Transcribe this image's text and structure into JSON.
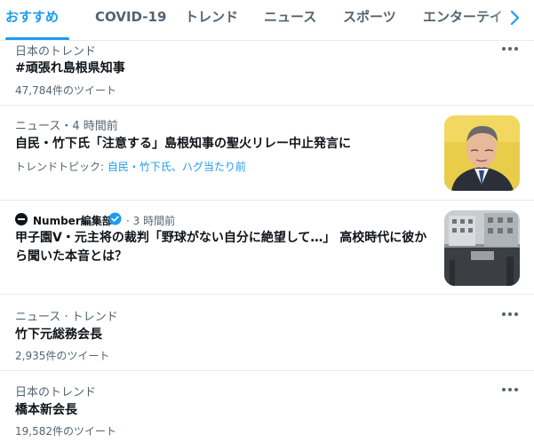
{
  "tabs": [
    {
      "label": "おすすめ",
      "active": true
    },
    {
      "label": "COVID-19",
      "active": false
    },
    {
      "label": "トレンド",
      "active": false
    },
    {
      "label": "ニュース",
      "active": false
    },
    {
      "label": "スポーツ",
      "active": false
    },
    {
      "label": "エンターテイ",
      "active": false
    }
  ],
  "colors": {
    "accent": "#1d9bf0",
    "text": "#0f1419",
    "muted": "#536471",
    "border": "#e6ecf0"
  },
  "trend1": {
    "meta": "日本のトレンド",
    "title": "#頑張れ島根県知事",
    "count": "47,784件のツイート"
  },
  "news1": {
    "meta": "ニュース・4 時間前",
    "headline": "自民・竹下氏「注意する」島根知事の聖火リレー中止発言に",
    "topic_label": "トレンドトピック: ",
    "topic_links": "自民・竹下氏、ハグ当たり前",
    "thumb_icon": "news-photo-thumbnail"
  },
  "news2": {
    "author": "Number編集部",
    "time": "· 3 時間前",
    "headline": "甲子園V・元主将の裁判「野球がない自分に絶望して…」 高校時代に彼から聞いた本音とは？",
    "thumb_icon": "courthouse-photo-thumbnail"
  },
  "trend2": {
    "meta": "ニュース · トレンド",
    "title": "竹下元総務会長",
    "count": "2,935件のツイート"
  },
  "trend3": {
    "meta": "日本のトレンド",
    "title": "橋本新会長",
    "count": "19,582件のツイート"
  }
}
